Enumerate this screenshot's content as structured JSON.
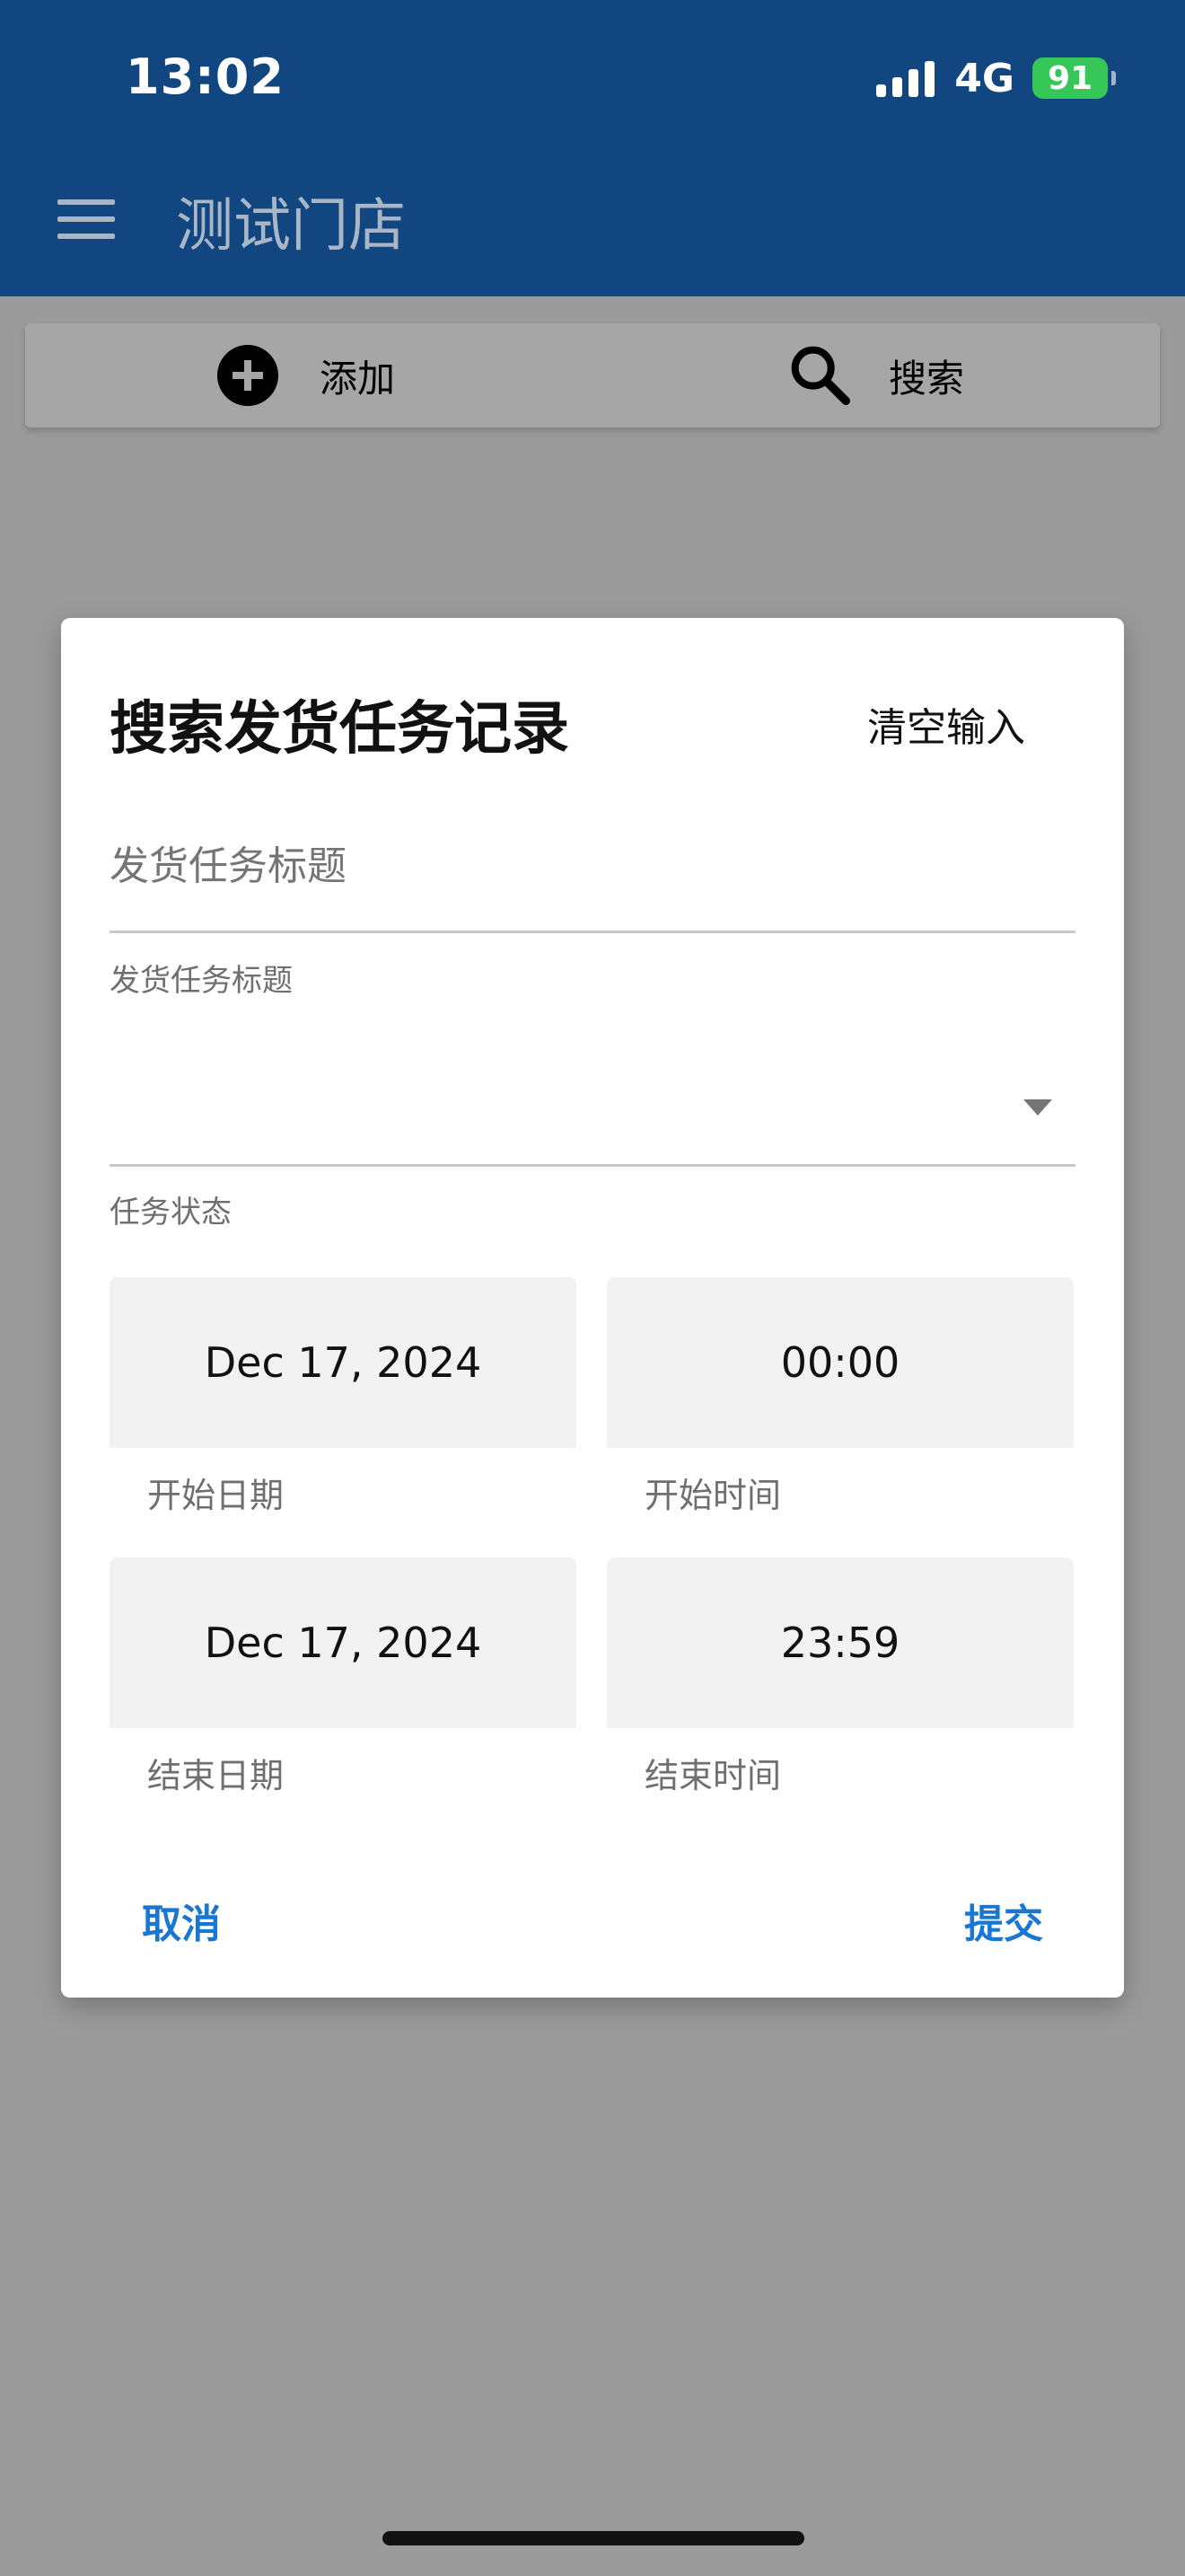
{
  "status_bar": {
    "time": "13:02",
    "network": "4G",
    "battery": "91"
  },
  "app_bar": {
    "title": "测试门店"
  },
  "toolbar": {
    "add_label": "添加",
    "search_label": "搜索"
  },
  "dialog": {
    "title": "搜索发货任务记录",
    "clear_label": "清空输入",
    "title_input_placeholder": "发货任务标题",
    "title_helper": "发货任务标题",
    "status_helper": "任务状态",
    "start_date": "Dec 17, 2024",
    "start_date_label": "开始日期",
    "start_time": "00:00",
    "start_time_label": "开始时间",
    "end_date": "Dec 17, 2024",
    "end_date_label": "结束日期",
    "end_time": "23:59",
    "end_time_label": "结束时间",
    "cancel_label": "取消",
    "submit_label": "提交"
  },
  "colors": {
    "app_bar": "#114681",
    "scrim_background": "#9b9b9b",
    "accent": "#1976d2",
    "battery": "#37c759"
  },
  "icons": [
    "menu-icon",
    "add-circle-icon",
    "search-icon",
    "dropdown-arrow-icon",
    "signal-icon",
    "battery-icon"
  ]
}
